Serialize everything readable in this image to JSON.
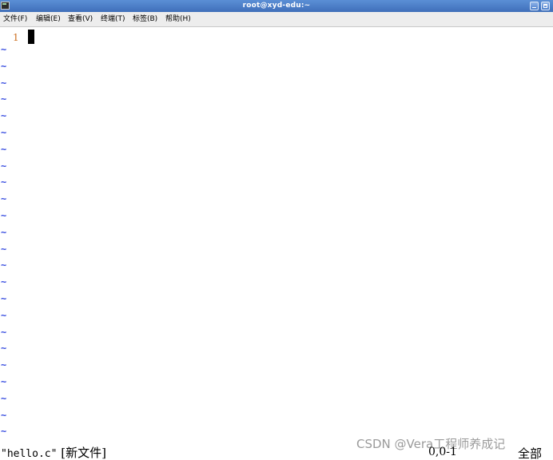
{
  "window": {
    "title": "root@xyd-edu:~"
  },
  "menubar": {
    "items": [
      {
        "label": "文件(F)"
      },
      {
        "label": "编辑(E)"
      },
      {
        "label": "查看(V)"
      },
      {
        "label": "终端(T)"
      },
      {
        "label": "标签(B)"
      },
      {
        "label": "帮助(H)"
      }
    ]
  },
  "editor": {
    "line_numbers": [
      "1"
    ],
    "empty_line_marker": "~",
    "empty_line_count": 24
  },
  "statusline": {
    "filename": "\"hello.c\"",
    "file_state": "[新文件]",
    "position": "0,0-1",
    "scroll": "全部"
  },
  "watermark": {
    "text": "CSDN @Vera工程师养成记"
  },
  "colors": {
    "titlebar": "#3f6fb9",
    "line_number": "#cc6e1f",
    "tilde": "#3a4fe0"
  }
}
